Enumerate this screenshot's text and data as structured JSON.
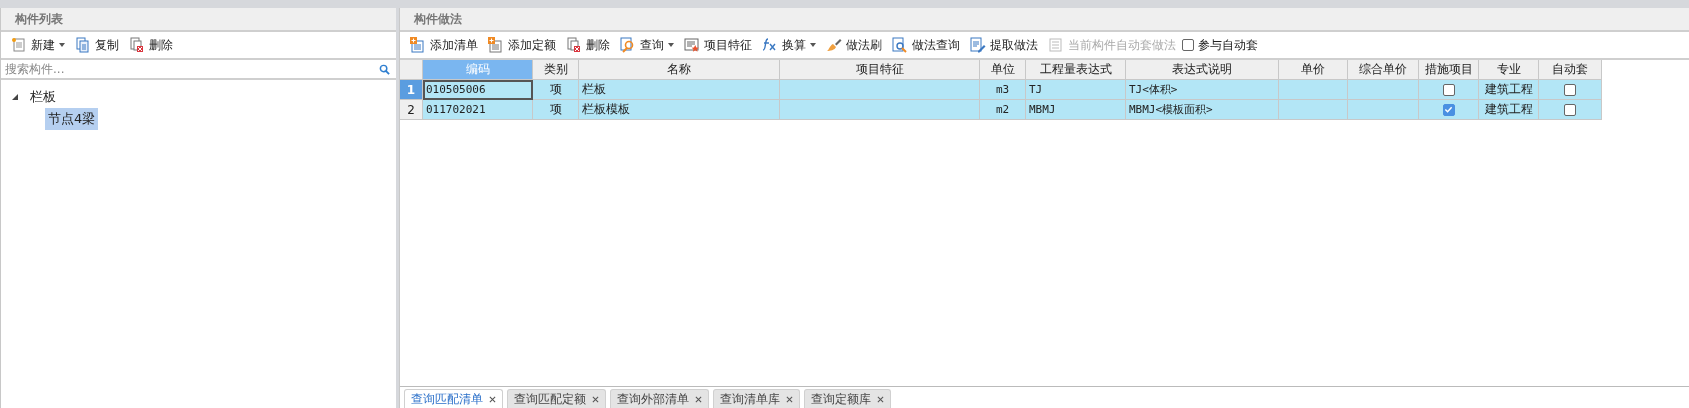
{
  "left_panel": {
    "title": "构件列表",
    "toolbar": [
      {
        "label": "新建",
        "kind": "new",
        "dropdown": true,
        "disabled": false
      },
      {
        "label": "复制",
        "kind": "copy",
        "dropdown": false,
        "disabled": false
      },
      {
        "label": "删除",
        "kind": "delete",
        "dropdown": false,
        "disabled": false
      }
    ],
    "search": {
      "placeholder": "搜索构件..."
    },
    "tree": [
      {
        "label": "栏板",
        "expanded": true,
        "selected": false,
        "children": [
          {
            "label": "节点4梁",
            "selected": true
          }
        ]
      }
    ]
  },
  "right_panel": {
    "title": "构件做法",
    "toolbar": [
      {
        "label": "添加清单",
        "kind": "add-list",
        "dropdown": false,
        "disabled": false
      },
      {
        "label": "添加定额",
        "kind": "add-quota",
        "dropdown": false,
        "disabled": false
      },
      {
        "label": "删除",
        "kind": "delete",
        "dropdown": false,
        "disabled": false
      },
      {
        "label": "查询",
        "kind": "search",
        "dropdown": true,
        "disabled": false
      },
      {
        "label": "项目特征",
        "kind": "feature",
        "dropdown": false,
        "disabled": false
      },
      {
        "label": "换算",
        "kind": "fx",
        "dropdown": true,
        "disabled": false
      },
      {
        "label": "做法刷",
        "kind": "brush",
        "dropdown": false,
        "disabled": false
      },
      {
        "label": "做法查询",
        "kind": "doc-search",
        "dropdown": false,
        "disabled": false
      },
      {
        "label": "提取做法",
        "kind": "extract",
        "dropdown": false,
        "disabled": false
      },
      {
        "label": "当前构件自动套做法",
        "kind": "auto",
        "dropdown": false,
        "disabled": true
      }
    ],
    "auto_checkbox": {
      "label": "参与自动套",
      "checked": false
    },
    "table": {
      "columns": [
        {
          "label": "编码",
          "selected": true
        },
        {
          "label": "类别",
          "selected": false
        },
        {
          "label": "名称",
          "selected": false
        },
        {
          "label": "项目特征",
          "selected": false
        },
        {
          "label": "单位",
          "selected": false
        },
        {
          "label": "工程量表达式",
          "selected": false
        },
        {
          "label": "表达式说明",
          "selected": false
        },
        {
          "label": "单价",
          "selected": false
        },
        {
          "label": "综合单价",
          "selected": false
        },
        {
          "label": "措施项目",
          "selected": false
        },
        {
          "label": "专业",
          "selected": false
        },
        {
          "label": "自动套",
          "selected": false
        }
      ],
      "rows": [
        {
          "row_number": "1",
          "selected": true,
          "code": "010505006",
          "type": "项",
          "name": "栏板",
          "unit": "m3",
          "expression": "TJ",
          "expression_note": "TJ<体积>",
          "measure": false,
          "specialty": "建筑工程",
          "auto": false
        },
        {
          "row_number": "2",
          "selected": false,
          "code": "011702021",
          "type": "项",
          "name": "栏板模板",
          "unit": "m2",
          "expression": "MBMJ",
          "expression_note": "MBMJ<模板面积>",
          "measure": true,
          "specialty": "建筑工程",
          "auto": false
        }
      ]
    },
    "bottom_tabs": [
      {
        "label": "查询匹配清单",
        "selected": true
      },
      {
        "label": "查询匹配定额",
        "selected": false
      },
      {
        "label": "查询外部清单",
        "selected": false
      },
      {
        "label": "查询清单库",
        "selected": false
      },
      {
        "label": "查询定额库",
        "selected": false
      }
    ]
  }
}
